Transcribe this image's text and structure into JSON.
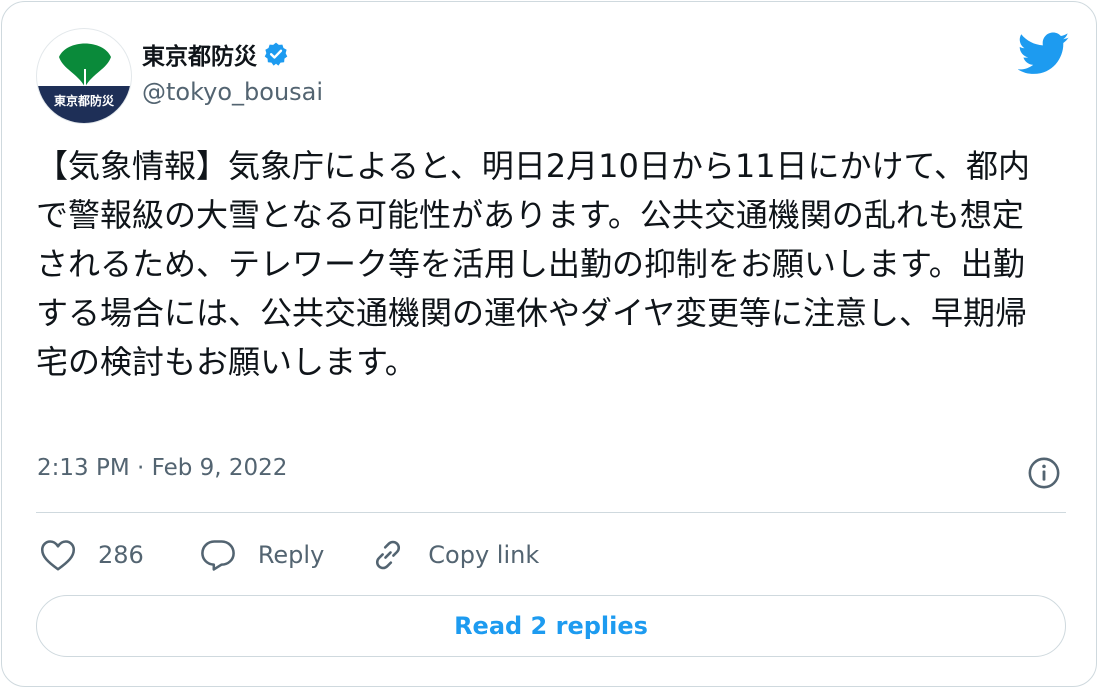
{
  "author": {
    "display_name": "東京都防災",
    "handle": "@tokyo_bousai",
    "avatar_label": "東京都防災",
    "verified": true
  },
  "tweet": {
    "text": "【気象情報】気象庁によると、明日2月10日から11日にかけて、都内で警報級の大雪となる可能性があります。公共交通機関の乱れも想定されるため、テレワーク等を活用し出勤の抑制をお願いします。出勤する場合には、公共交通機関の運休やダイヤ変更等に注意し、早期帰宅の検討もお願いします。",
    "timestamp": "2:13 PM · Feb 9, 2022"
  },
  "actions": {
    "like_count": "286",
    "reply_label": "Reply",
    "copy_link_label": "Copy link"
  },
  "read_replies_label": "Read 2 replies",
  "icons": {
    "brand": "twitter-bird-icon",
    "verified": "verified-badge-icon",
    "info": "info-icon",
    "like": "heart-icon",
    "reply": "speech-bubble-icon",
    "copy": "link-icon"
  },
  "colors": {
    "accent": "#1d9bf0",
    "text": "#0f1419",
    "secondary_text": "#536471",
    "border": "#cfd9de",
    "avatar_leaf": "#0a8a3a",
    "avatar_band": "#1e2f57"
  }
}
